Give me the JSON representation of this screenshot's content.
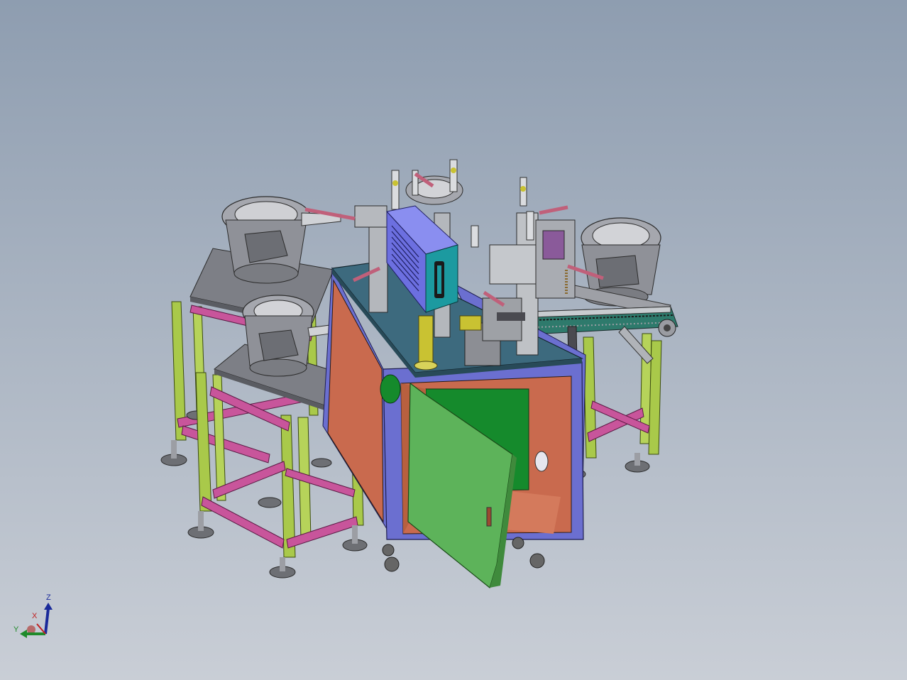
{
  "view": {
    "background_top": "#8e9db0",
    "background_bottom": "#c9ced6"
  },
  "model": {
    "frame_color": "#a9c94a",
    "brace_color": "#c8559b",
    "base_frame_color": "#6b6fd0",
    "panel_color": "#c96a4e",
    "door_color": "#5db35a",
    "plate_color": "#3d6a7e",
    "control_box_color": "#6c6fe0",
    "control_box_face_color": "#1c9aa0",
    "feeder_bowl_color": "#9a9ca4",
    "column_color": "#c9c232"
  },
  "triad": {
    "x_label": "X",
    "y_label": "Y",
    "z_label": "Z",
    "x_color": "#c02020",
    "y_color": "#1f8a2a",
    "z_color": "#1a2a9a"
  }
}
